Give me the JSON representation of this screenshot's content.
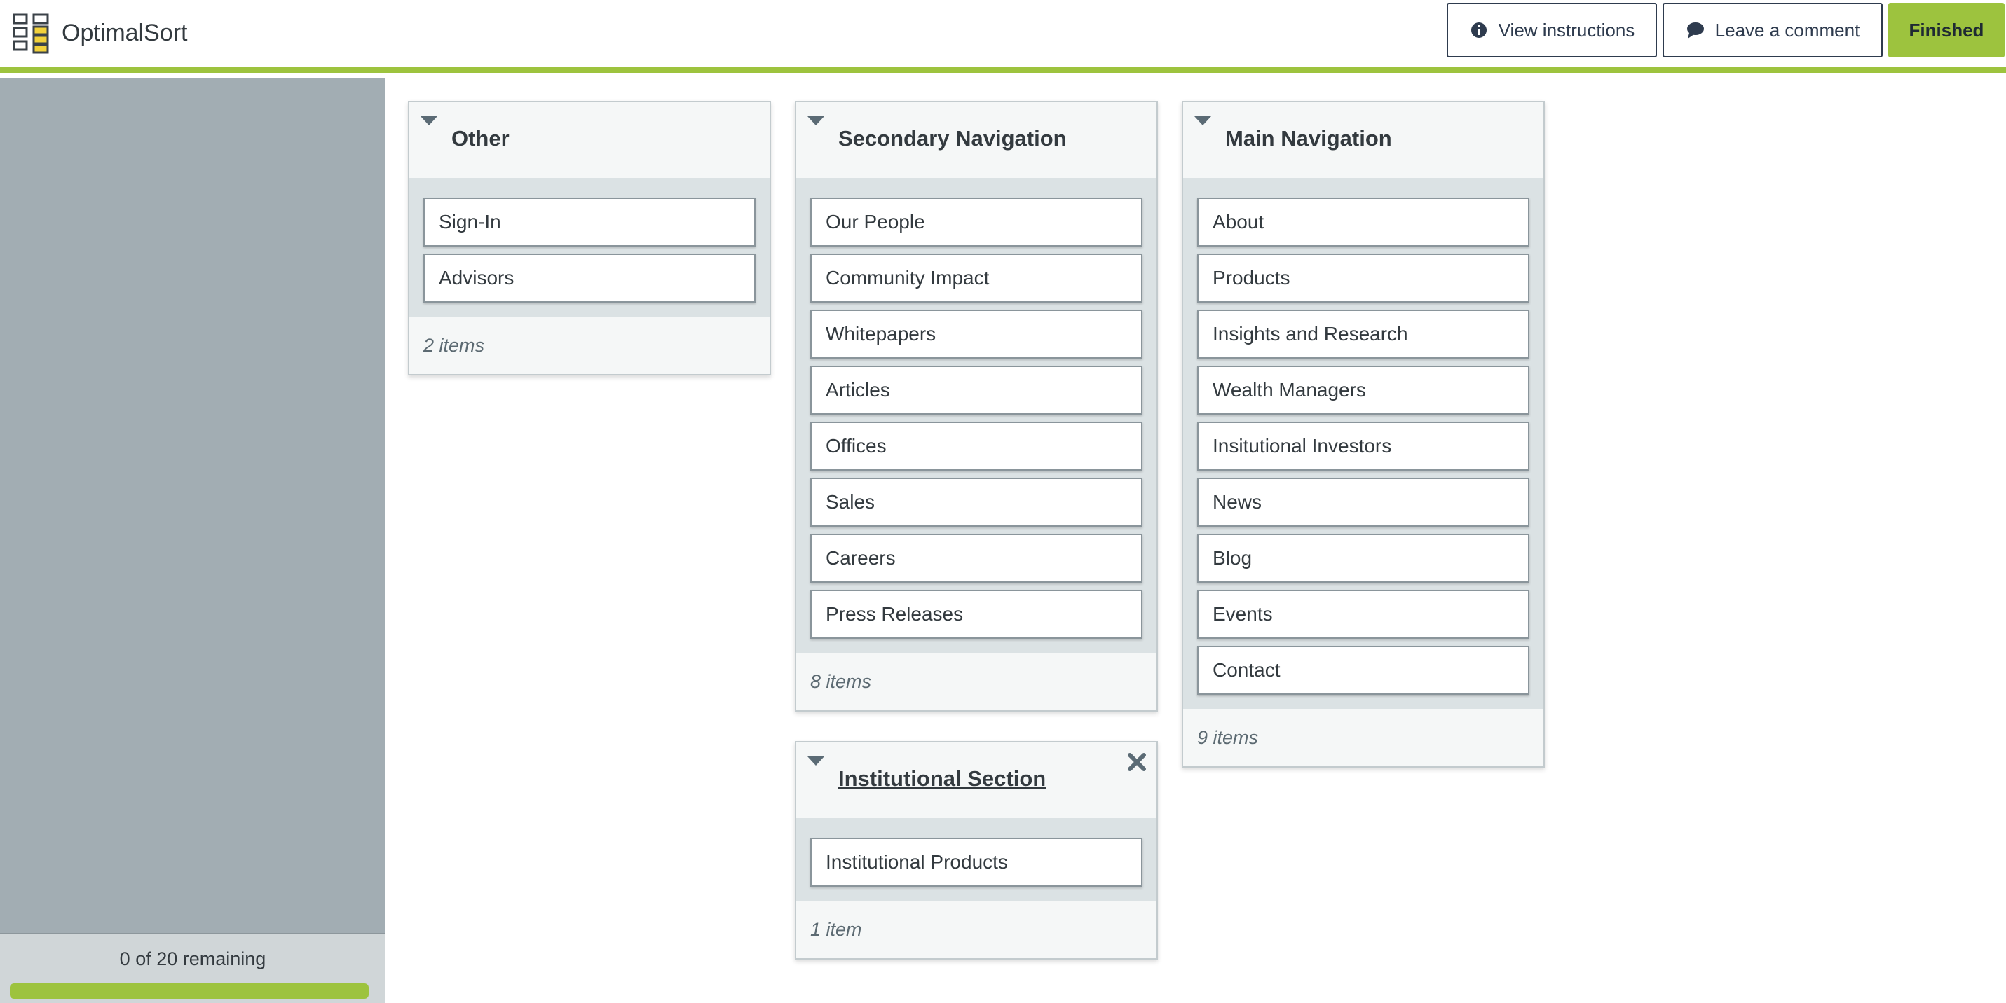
{
  "app": {
    "title": "OptimalSort"
  },
  "header": {
    "instructions_label": "View instructions",
    "comment_label": "Leave a comment",
    "finished_label": "Finished"
  },
  "sidebar": {
    "remaining_text": "0 of 20 remaining",
    "progress": 1.0
  },
  "groups": {
    "other": {
      "title": "Other",
      "cards": [
        "Sign-In",
        "Advisors"
      ],
      "count": "2 items"
    },
    "secondary": {
      "title": "Secondary Navigation",
      "cards": [
        "Our People",
        "Community Impact",
        "Whitepapers",
        "Articles",
        "Offices",
        "Sales",
        "Careers",
        "Press Releases"
      ],
      "count": "8 items"
    },
    "main": {
      "title": "Main Navigation",
      "cards": [
        "About",
        "Products",
        "Insights and Research",
        "Wealth Managers",
        "Insitutional Investors",
        "News",
        "Blog",
        "Events",
        "Contact"
      ],
      "count": "9 items"
    },
    "institutional": {
      "title": "Institutional Section",
      "cards": [
        "Institutional Products"
      ],
      "count": "1 item"
    }
  },
  "colors": {
    "accent": "#9dc33e",
    "sidebar": "#a2adb3",
    "text": "#333a3f"
  },
  "icons": {
    "logo": "card-sort-logo-icon",
    "instructions": "info-circle-icon",
    "comment": "speech-bubble-icon",
    "collapse": "caret-down-icon",
    "remove": "close-icon"
  }
}
